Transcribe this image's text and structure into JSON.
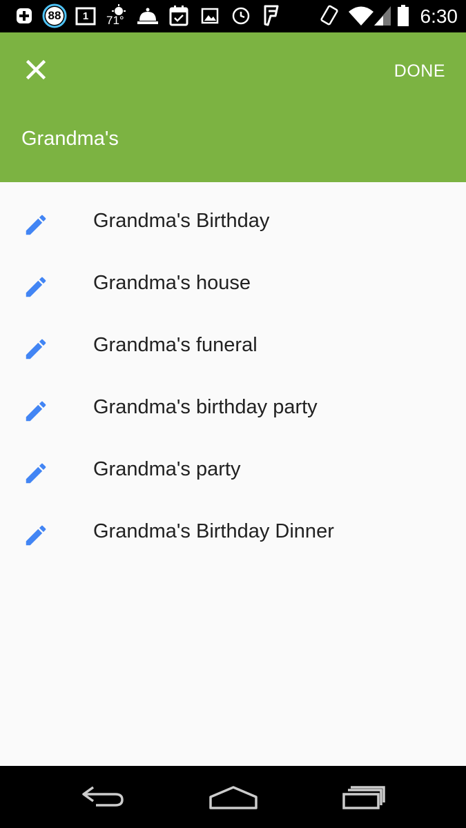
{
  "status_bar": {
    "time": "6:30",
    "notification_count": "88",
    "calendar_day": "1",
    "temperature": "71°",
    "icons": [
      "add-box-icon",
      "badge-88-icon",
      "calendar-1-icon",
      "weather-icon",
      "bell-icon",
      "calendar-check-icon",
      "image-icon",
      "clock-icon",
      "foursquare-icon",
      "rotate-icon",
      "wifi-icon",
      "signal-icon",
      "battery-icon"
    ]
  },
  "app_bar": {
    "close_icon": "close-icon",
    "done_label": "DONE",
    "query": "Grandma's",
    "color": "#7cb342"
  },
  "suggestions": [
    {
      "label": "Grandma's Birthday",
      "icon": "pencil-icon"
    },
    {
      "label": "Grandma's house",
      "icon": "pencil-icon"
    },
    {
      "label": "Grandma's funeral",
      "icon": "pencil-icon"
    },
    {
      "label": "Grandma's birthday party",
      "icon": "pencil-icon"
    },
    {
      "label": "Grandma's party",
      "icon": "pencil-icon"
    },
    {
      "label": "Grandma's Birthday Dinner",
      "icon": "pencil-icon"
    }
  ],
  "colors": {
    "accent_icon": "#4285f4",
    "text": "#212121",
    "background": "#fafafa"
  },
  "nav_bar": {
    "icons": [
      "back-icon",
      "home-icon",
      "recents-icon"
    ]
  }
}
